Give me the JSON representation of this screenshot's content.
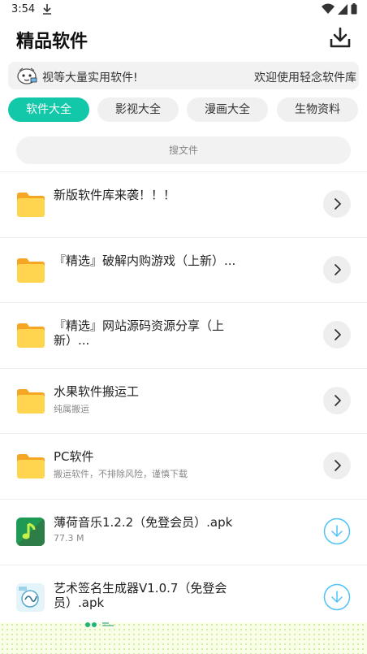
{
  "status_bar": {
    "time": "3:54"
  },
  "header": {
    "title": "精品软件"
  },
  "marquee": {
    "text_left": "视等大量实用软件!",
    "text_right": "欢迎使用轻念软件库"
  },
  "tabs": [
    {
      "label": "软件大全",
      "active": true
    },
    {
      "label": "影视大全",
      "active": false
    },
    {
      "label": "漫画大全",
      "active": false
    },
    {
      "label": "生物资料",
      "active": false
    }
  ],
  "search": {
    "placeholder": "搜文件"
  },
  "items": [
    {
      "title": "新版软件库来袭！！！",
      "subtitle": "",
      "kind": "folder",
      "action": "chevron-right-icon"
    },
    {
      "title": "『精选』破解内购游戏（上新）...",
      "subtitle": "",
      "kind": "folder",
      "action": "chevron-right-icon"
    },
    {
      "title": "『精选』网站源码资源分享（上新）...",
      "subtitle": "",
      "kind": "folder",
      "action": "chevron-right-icon"
    },
    {
      "title": "水果软件搬运工",
      "subtitle": "纯属搬运",
      "kind": "folder",
      "action": "chevron-right-icon"
    },
    {
      "title": "PC软件",
      "subtitle": "搬运软件，不排除风险，谨慎下载",
      "kind": "folder",
      "action": "chevron-right-icon"
    },
    {
      "title": "薄荷音乐1.2.2（免登会员）.apk",
      "subtitle": "77.3 M",
      "kind": "apk-music",
      "action": "download-icon"
    },
    {
      "title": "艺术签名生成器V1.0.7（免登会员）.apk",
      "subtitle": "",
      "kind": "apk-signature",
      "action": "download-icon"
    }
  ],
  "colors": {
    "accent": "#13c8a8",
    "folder": "#ffd54f",
    "download_ring": "#4fc3f7"
  }
}
